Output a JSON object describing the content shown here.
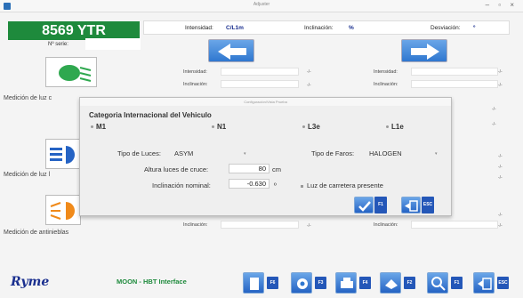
{
  "window": {
    "title": "Adjuster"
  },
  "vehicle": {
    "plate": "8569 YTR",
    "serie_label": "Nº serie:",
    "serie_value": ""
  },
  "topbar": {
    "intensidad_label": "Intensidad:",
    "intensidad_value": "C/L1m",
    "inclinacion_label": "Inclinación:",
    "inclinacion_value": "%",
    "desviacion_label": "Desviación:",
    "desviacion_value": "º"
  },
  "sections": [
    {
      "label": "Medición de luz c",
      "fields": [
        {
          "label": "Intensidad:",
          "unit": "-/-"
        },
        {
          "label": "Inclinación:",
          "unit": "-/-"
        },
        {
          "label": "Intensidad:",
          "unit": "-/-"
        },
        {
          "label": "Inclinación:",
          "unit": "-/-"
        }
      ]
    },
    {
      "label": "Medición de luz l"
    },
    {
      "label": "Medición de antinieblas",
      "fields": [
        {
          "label": "Inclinación:",
          "unit": "-/-"
        },
        {
          "label": "Inclinación:",
          "unit": "-/-"
        }
      ]
    }
  ],
  "right_units": [
    "-/-",
    "-/-",
    "-/-",
    "-/-",
    "-/-",
    "-/-",
    "-/-"
  ],
  "footer": {
    "logo": "Ryme",
    "app_name": "MOON - HBT Interface",
    "buttons": [
      {
        "icon": "document-icon",
        "key": "F6"
      },
      {
        "icon": "gear-icon",
        "key": "F3"
      },
      {
        "icon": "printer-icon",
        "key": "F4"
      },
      {
        "icon": "eraser-icon",
        "key": "F2"
      },
      {
        "icon": "magnifier-icon",
        "key": "F1"
      },
      {
        "icon": "exit-icon",
        "key": "ESC"
      }
    ]
  },
  "dialog": {
    "title": "Configuración/Vista Prueba",
    "heading": "Categoria Internacional del Vehiculo",
    "categories": [
      {
        "label": "M1",
        "selected": true
      },
      {
        "label": "N1",
        "selected": false
      },
      {
        "label": "L3e",
        "selected": false
      },
      {
        "label": "L1e",
        "selected": false
      }
    ],
    "tipo_luces_label": "Tipo de Luces:",
    "tipo_luces_value": "ASYM",
    "tipo_faros_label": "Tipo de Faros:",
    "tipo_faros_value": "HALOGEN",
    "altura_label": "Altura luces de cruce:",
    "altura_value": "80",
    "altura_unit": "cm",
    "inclinacion_label": "Inclinación nominal:",
    "inclinacion_value": "-0.630",
    "inclinacion_unit": "º",
    "carretera_label": "Luz de carretera presente",
    "buttons": [
      {
        "icon": "check-icon",
        "key": "F1"
      },
      {
        "icon": "exit-icon",
        "key": "ESC"
      }
    ]
  },
  "colors": {
    "plate_bg": "#1e8a3c",
    "accent_blue": "#2f77d0",
    "dark_blue": "#1a2f8f"
  }
}
